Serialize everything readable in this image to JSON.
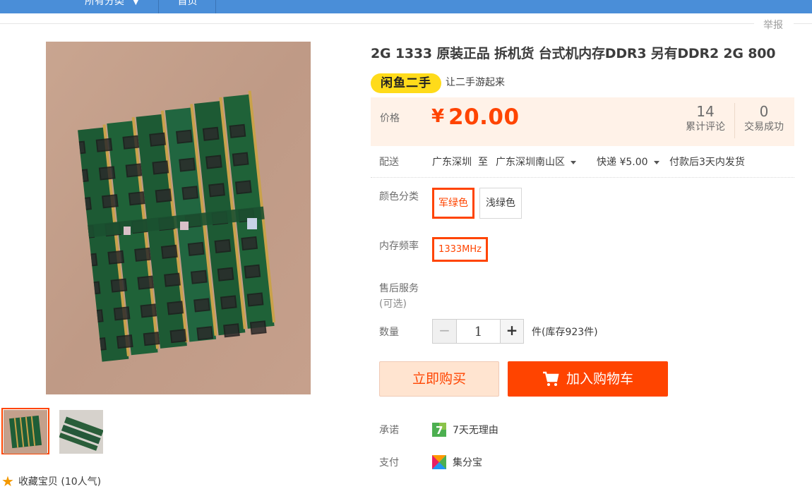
{
  "nav": {
    "all_categories": "所有分类",
    "home": "首页"
  },
  "report_label": "举报",
  "product": {
    "title": "2G 1333 原装正品 拆机货 台式机内存DDR3 另有DDR2 2G 800",
    "brand_badge": "闲鱼二手",
    "slogan": "让二手游起来"
  },
  "price": {
    "label": "价格",
    "currency": "¥",
    "value": "20.00",
    "stats": [
      {
        "num": "14",
        "label": "累计评论"
      },
      {
        "num": "0",
        "label": "交易成功"
      }
    ]
  },
  "shipping": {
    "label": "配送",
    "from": "广东深圳",
    "to_word": "至",
    "destination": "广东深圳南山区",
    "method": "快递 ¥5.00",
    "dispatch": "付款后3天内发货"
  },
  "options": {
    "color_label": "颜色分类",
    "colors": [
      "军绿色",
      "浅绿色"
    ],
    "selected_color": "军绿色",
    "freq_label": "内存频率",
    "freqs": [
      "1333MHz"
    ],
    "selected_freq": "1333MHz",
    "aftersale_label": "售后服务",
    "aftersale_sub": "(可选)"
  },
  "quantity": {
    "label": "数量",
    "value": "1",
    "minus": "−",
    "plus": "+",
    "stock": "件(库存923件)"
  },
  "actions": {
    "buy_now": "立即购买",
    "add_to_cart": "加入购物车"
  },
  "promise": {
    "label": "承诺",
    "text": "7天无理由"
  },
  "payment": {
    "label": "支付",
    "text": "集分宝"
  },
  "favorite": {
    "text": "收藏宝贝 (10人气)"
  },
  "colors": {
    "accent": "#ff4400",
    "nav": "#4a8ed8",
    "badge": "#ffdb1a",
    "price_bg": "#fff2e8"
  }
}
